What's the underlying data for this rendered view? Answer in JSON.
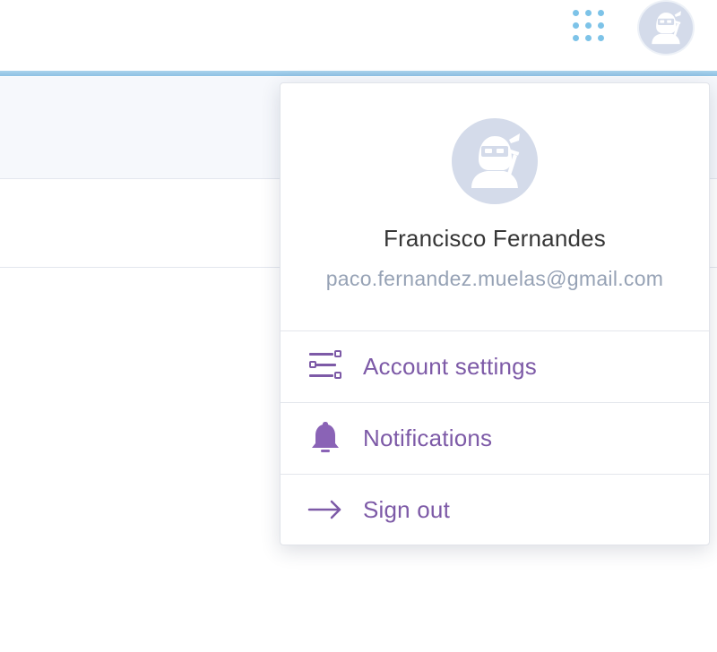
{
  "header": {
    "apps_icon": "apps-grid-icon",
    "avatar_icon": "ninja-avatar-icon"
  },
  "profile": {
    "name": "Francisco Fernandes",
    "email": "paco.fernandez.muelas@gmail.com",
    "avatar_icon": "ninja-avatar-icon"
  },
  "menu": {
    "items": [
      {
        "label": "Account settings",
        "icon": "settings-sliders-icon"
      },
      {
        "label": "Notifications",
        "icon": "bell-icon"
      },
      {
        "label": "Sign out",
        "icon": "arrow-right-icon"
      }
    ]
  },
  "colors": {
    "accent_line": "#8ec1e4",
    "apps_dots": "#7dc3e8",
    "avatar_bg": "#d4dbea",
    "menu_text": "#7d5aa7",
    "name_text": "#363636",
    "email_text": "#96a2b5"
  }
}
